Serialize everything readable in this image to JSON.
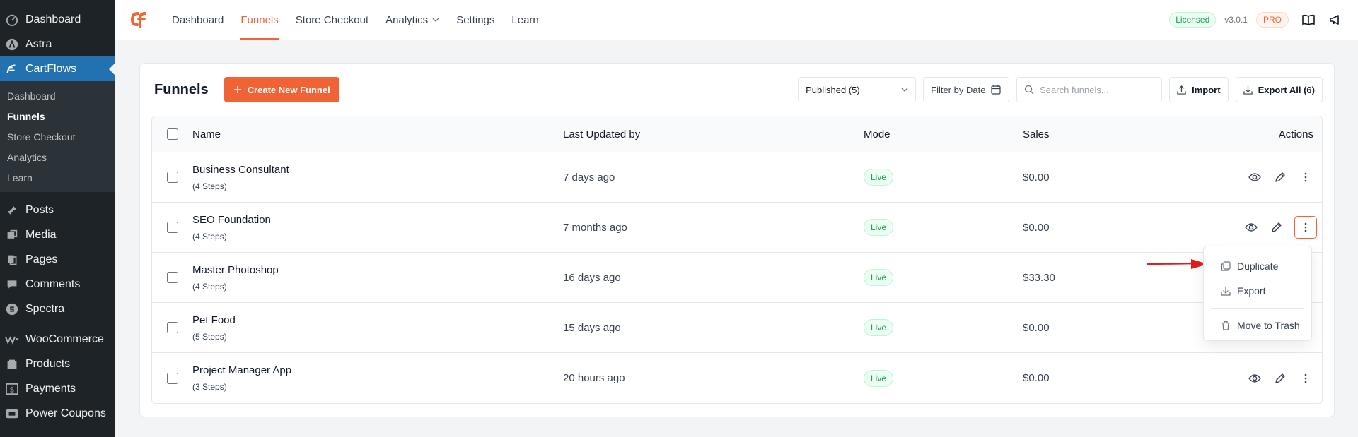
{
  "wp_sidebar": {
    "items": [
      {
        "label": "Dashboard",
        "icon": "dashboard-icon"
      },
      {
        "label": "Astra",
        "icon": "astra-icon"
      },
      {
        "label": "CartFlows",
        "icon": "cartflows-icon"
      }
    ],
    "submenu": [
      "Dashboard",
      "Funnels",
      "Store Checkout",
      "Analytics",
      "Learn"
    ],
    "items_after": [
      {
        "label": "Posts",
        "icon": "pin-icon"
      },
      {
        "label": "Media",
        "icon": "media-icon"
      },
      {
        "label": "Pages",
        "icon": "pages-icon"
      },
      {
        "label": "Comments",
        "icon": "comments-icon"
      },
      {
        "label": "Spectra",
        "icon": "spectra-icon"
      },
      {
        "label": "WooCommerce",
        "icon": "woocommerce-icon"
      },
      {
        "label": "Products",
        "icon": "products-icon"
      },
      {
        "label": "Payments",
        "icon": "payments-icon"
      },
      {
        "label": "Power Coupons",
        "icon": "coupons-icon"
      }
    ]
  },
  "topnav": {
    "items": [
      "Dashboard",
      "Funnels",
      "Store Checkout",
      "Analytics",
      "Settings",
      "Learn"
    ],
    "active": "Funnels",
    "licensed": "Licensed",
    "version": "v3.0.1",
    "pro": "PRO"
  },
  "funnels": {
    "title": "Funnels",
    "create_label": "Create New Funnel",
    "status_filter": "Published (5)",
    "date_filter": "Filter by Date",
    "search_placeholder": "Search funnels...",
    "import_label": "Import",
    "export_all_label": "Export All (6)",
    "columns": [
      "Name",
      "Last Updated by",
      "Mode",
      "Sales",
      "Actions"
    ],
    "rows": [
      {
        "name": "Business Consultant",
        "steps": "(4 Steps)",
        "updated": "7 days ago",
        "mode": "Live",
        "sales": "$0.00"
      },
      {
        "name": "SEO Foundation",
        "steps": "(4 Steps)",
        "updated": "7 months ago",
        "mode": "Live",
        "sales": "$0.00"
      },
      {
        "name": "Master Photoshop",
        "steps": "(4 Steps)",
        "updated": "16 days ago",
        "mode": "Live",
        "sales": "$33.30"
      },
      {
        "name": "Pet Food",
        "steps": "(5 Steps)",
        "updated": "15 days ago",
        "mode": "Live",
        "sales": "$0.00"
      },
      {
        "name": "Project Manager App",
        "steps": "(3 Steps)",
        "updated": "20 hours ago",
        "mode": "Live",
        "sales": "$0.00"
      }
    ]
  },
  "menu": {
    "duplicate": "Duplicate",
    "export": "Export",
    "trash": "Move to Trash"
  },
  "colors": {
    "accent": "#f06335",
    "sidebar": "#1d2327",
    "wp_active": "#2271b1",
    "live": "#16a34a",
    "arrow": "#e11d1d"
  }
}
